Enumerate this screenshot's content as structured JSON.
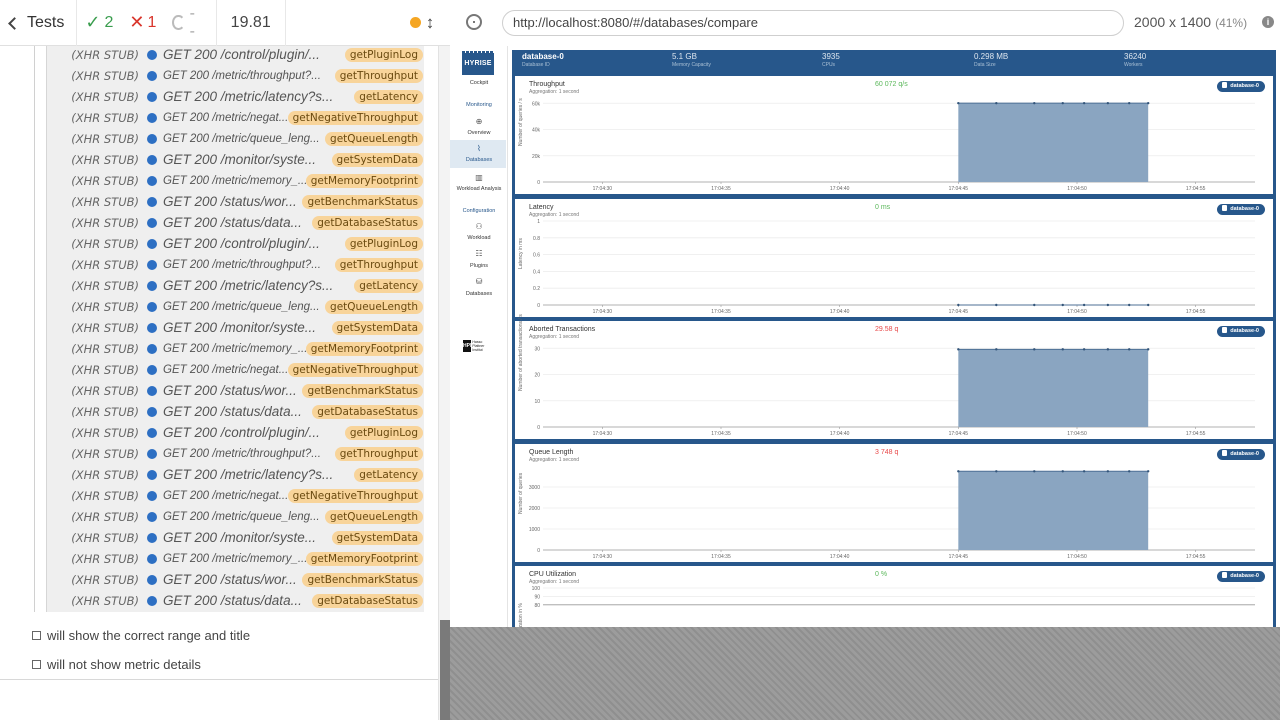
{
  "runner": {
    "tests_label": "Tests",
    "passed": "2",
    "failed": "1",
    "pending": "--",
    "duration": "19.81",
    "commands": [
      {
        "stub": "(XHR STUB)",
        "msg": "GET 200 /control/plugin/...",
        "alias": "getPluginLog",
        "size": "big"
      },
      {
        "stub": "(XHR STUB)",
        "msg": "GET 200 /metric/throughput?...",
        "alias": "getThroughput",
        "size": "small"
      },
      {
        "stub": "(XHR STUB)",
        "msg": "GET 200 /metric/latency?s...",
        "alias": "getLatency",
        "size": "big"
      },
      {
        "stub": "(XHR STUB)",
        "msg": "GET 200 /metric/negat...",
        "alias": "getNegativeThroughput",
        "size": "small"
      },
      {
        "stub": "(XHR STUB)",
        "msg": "GET 200 /metric/queue_leng...",
        "alias": "getQueueLength",
        "size": "small"
      },
      {
        "stub": "(XHR STUB)",
        "msg": "GET 200 /monitor/syste...",
        "alias": "getSystemData",
        "size": "big"
      },
      {
        "stub": "(XHR STUB)",
        "msg": "GET 200 /metric/memory_...",
        "alias": "getMemoryFootprint",
        "size": "small"
      },
      {
        "stub": "(XHR STUB)",
        "msg": "GET 200 /status/wor...",
        "alias": "getBenchmarkStatus",
        "size": "big"
      },
      {
        "stub": "(XHR STUB)",
        "msg": "GET 200 /status/data...",
        "alias": "getDatabaseStatus",
        "size": "big"
      },
      {
        "stub": "(XHR STUB)",
        "msg": "GET 200 /control/plugin/...",
        "alias": "getPluginLog",
        "size": "big"
      },
      {
        "stub": "(XHR STUB)",
        "msg": "GET 200 /metric/throughput?...",
        "alias": "getThroughput",
        "size": "small"
      },
      {
        "stub": "(XHR STUB)",
        "msg": "GET 200 /metric/latency?s...",
        "alias": "getLatency",
        "size": "big"
      },
      {
        "stub": "(XHR STUB)",
        "msg": "GET 200 /metric/queue_leng...",
        "alias": "getQueueLength",
        "size": "small"
      },
      {
        "stub": "(XHR STUB)",
        "msg": "GET 200 /monitor/syste...",
        "alias": "getSystemData",
        "size": "big"
      },
      {
        "stub": "(XHR STUB)",
        "msg": "GET 200 /metric/memory_...",
        "alias": "getMemoryFootprint",
        "size": "small"
      },
      {
        "stub": "(XHR STUB)",
        "msg": "GET 200 /metric/negat...",
        "alias": "getNegativeThroughput",
        "size": "small"
      },
      {
        "stub": "(XHR STUB)",
        "msg": "GET 200 /status/wor...",
        "alias": "getBenchmarkStatus",
        "size": "big"
      },
      {
        "stub": "(XHR STUB)",
        "msg": "GET 200 /status/data...",
        "alias": "getDatabaseStatus",
        "size": "big"
      },
      {
        "stub": "(XHR STUB)",
        "msg": "GET 200 /control/plugin/...",
        "alias": "getPluginLog",
        "size": "big"
      },
      {
        "stub": "(XHR STUB)",
        "msg": "GET 200 /metric/throughput?...",
        "alias": "getThroughput",
        "size": "small"
      },
      {
        "stub": "(XHR STUB)",
        "msg": "GET 200 /metric/latency?s...",
        "alias": "getLatency",
        "size": "big"
      },
      {
        "stub": "(XHR STUB)",
        "msg": "GET 200 /metric/negat...",
        "alias": "getNegativeThroughput",
        "size": "small"
      },
      {
        "stub": "(XHR STUB)",
        "msg": "GET 200 /metric/queue_leng...",
        "alias": "getQueueLength",
        "size": "small"
      },
      {
        "stub": "(XHR STUB)",
        "msg": "GET 200 /monitor/syste...",
        "alias": "getSystemData",
        "size": "big"
      },
      {
        "stub": "(XHR STUB)",
        "msg": "GET 200 /metric/memory_...",
        "alias": "getMemoryFootprint",
        "size": "small"
      },
      {
        "stub": "(XHR STUB)",
        "msg": "GET 200 /status/wor...",
        "alias": "getBenchmarkStatus",
        "size": "big"
      },
      {
        "stub": "(XHR STUB)",
        "msg": "GET 200 /status/data...",
        "alias": "getDatabaseStatus",
        "size": "big"
      }
    ],
    "pending_tests": [
      "will show the correct range and title",
      "will not show metric details"
    ]
  },
  "browser": {
    "url": "http://localhost:8080/#/databases/compare",
    "viewport": "2000 x 1400",
    "zoom": "(41%)"
  },
  "cockpit": {
    "logo_text": "HYRISE",
    "logo_caption": "Cockpit",
    "nav": {
      "monitoring_heading": "Monitoring",
      "overview": "Overview",
      "databases": "Databases",
      "workload_analysis": "Workload Analysis",
      "configuration_heading": "Configuration",
      "workload": "Workload",
      "plugins": "Plugins",
      "databases_config": "Databases"
    },
    "hpi_text": "HPI",
    "hpi_caption": "Hasso Plattner Institut",
    "database": {
      "name": "database-0",
      "name_label": "Database ID",
      "memory": "5.1 GB",
      "memory_label": "Memory Capacity",
      "cpus": "3935",
      "cpus_label": "CPUs",
      "data_size": "0.298 MB",
      "data_size_label": "Data Size",
      "workers": "36240",
      "workers_label": "Workers"
    },
    "metrics": [
      {
        "title": "Throughput",
        "aggregation": "Aggregation: 1 second",
        "value": "60 072 q/s",
        "value_color": "green",
        "badge": "database-0",
        "ylabel": "Number of queries / s"
      },
      {
        "title": "Latency",
        "aggregation": "Aggregation: 1 second",
        "value": "0 ms",
        "value_color": "green",
        "badge": "database-0",
        "ylabel": "Latency in ms"
      },
      {
        "title": "Aborted Transactions",
        "aggregation": "Aggregation: 1 second",
        "value": "29.58 q",
        "value_color": "red",
        "badge": "database-0",
        "ylabel": "Number of aborted transactions / s"
      },
      {
        "title": "Queue Length",
        "aggregation": "Aggregation: 1 second",
        "value": "3 748 q",
        "value_color": "red",
        "badge": "database-0",
        "ylabel": "Number of queries"
      },
      {
        "title": "CPU Utilization",
        "aggregation": "Aggregation: 1 second",
        "value": "0 %",
        "value_color": "green",
        "badge": "database-0",
        "ylabel": "Utilization in %"
      }
    ]
  },
  "chart_data": [
    {
      "type": "area",
      "title": "Throughput",
      "ylabel": "Number of queries / s",
      "x": [
        "17:04:30",
        "17:04:35",
        "17:04:40",
        "17:04:45",
        "17:04:50",
        "17:04:55"
      ],
      "y_ticks": [
        "0",
        "20k",
        "40k",
        "60k"
      ],
      "ylim": [
        0,
        64000
      ],
      "series": [
        {
          "name": "database-0",
          "x": [
            45,
            46.6,
            48.2,
            49.4,
            50.3,
            51.3,
            52.2,
            53
          ],
          "values": [
            60072,
            60072,
            60072,
            60072,
            60072,
            60072,
            60072,
            60072
          ]
        }
      ]
    },
    {
      "type": "line",
      "title": "Latency",
      "ylabel": "Latency in ms",
      "x": [
        "17:04:30",
        "17:04:35",
        "17:04:40",
        "17:04:45",
        "17:04:50",
        "17:04:55"
      ],
      "y_ticks": [
        "0",
        "0.2",
        "0.4",
        "0.6",
        "0.8",
        "1"
      ],
      "ylim": [
        0,
        1
      ],
      "series": [
        {
          "name": "database-0",
          "x": [
            45,
            46.6,
            48.2,
            49.4,
            50.3,
            51.3,
            52.2,
            53
          ],
          "values": [
            0,
            0,
            0,
            0,
            0,
            0,
            0,
            0
          ]
        }
      ]
    },
    {
      "type": "area",
      "title": "Aborted Transactions",
      "ylabel": "Number of aborted transactions / s",
      "x": [
        "17:04:30",
        "17:04:35",
        "17:04:40",
        "17:04:45",
        "17:04:50",
        "17:04:55"
      ],
      "y_ticks": [
        "0",
        "10",
        "20",
        "30"
      ],
      "ylim": [
        0,
        32
      ],
      "series": [
        {
          "name": "database-0",
          "x": [
            45,
            46.6,
            48.2,
            49.4,
            50.3,
            51.3,
            52.2,
            53
          ],
          "values": [
            29.58,
            29.58,
            29.58,
            29.58,
            29.58,
            29.58,
            29.58,
            29.58
          ]
        }
      ]
    },
    {
      "type": "area",
      "title": "Queue Length",
      "ylabel": "Number of queries",
      "x": [
        "17:04:30",
        "17:04:35",
        "17:04:40",
        "17:04:45",
        "17:04:50",
        "17:04:55"
      ],
      "y_ticks": [
        "0",
        "1000",
        "2000",
        "3000"
      ],
      "ylim": [
        0,
        4000
      ],
      "series": [
        {
          "name": "database-0",
          "x": [
            45,
            46.6,
            48.2,
            49.4,
            50.3,
            51.3,
            52.2,
            53
          ],
          "values": [
            3748,
            3748,
            3748,
            3748,
            3748,
            3748,
            3748,
            3748
          ]
        }
      ]
    },
    {
      "type": "line",
      "title": "CPU Utilization",
      "ylabel": "Utilization in %",
      "y_ticks": [
        "80",
        "90",
        "100"
      ],
      "ylim": [
        0,
        100
      ],
      "series": []
    }
  ]
}
